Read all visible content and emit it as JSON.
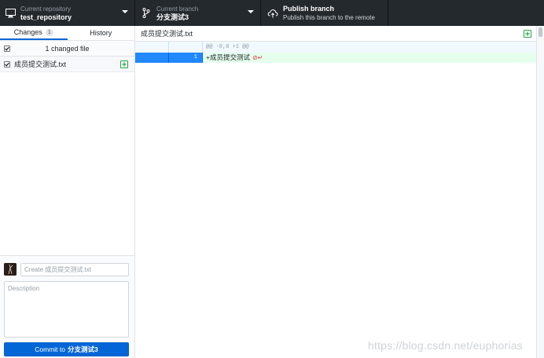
{
  "toolbar": {
    "repository": {
      "label": "Current repository",
      "value": "test_repository",
      "icon": "monitor-icon"
    },
    "branch": {
      "label": "Current branch",
      "value": "分支测试3",
      "icon": "git-branch-icon"
    },
    "publish": {
      "title": "Publish branch",
      "description": "Publish this branch to the remote",
      "icon": "cloud-upload-icon"
    }
  },
  "sidebar": {
    "tabs": [
      {
        "label": "Changes",
        "badge": "1",
        "selected": true
      },
      {
        "label": "History",
        "selected": false
      }
    ],
    "changed_files_header": "1 changed file",
    "files": [
      {
        "name": "成员提交测试.txt",
        "checked": true,
        "status": "added"
      }
    ]
  },
  "commit": {
    "summary_placeholder": "Create 成员提交测试.txt",
    "description_placeholder": "Description",
    "button_prefix": "Commit to",
    "button_branch": "分支测试3"
  },
  "diff": {
    "file_name": "成员提交测试.txt",
    "hunk_header": "@@ -0,0 +1 @@",
    "lines": [
      {
        "new_line_number": "1",
        "text": "+成员提交测试"
      }
    ]
  },
  "watermark": "https://blog.csdn.net/euphorias",
  "colors": {
    "toolbar_bg": "#24292e",
    "accent_blue": "#0366d6",
    "added_green": "#28a745",
    "added_line_bg": "#e6ffed",
    "hunk_bg": "#f1f8ff"
  }
}
